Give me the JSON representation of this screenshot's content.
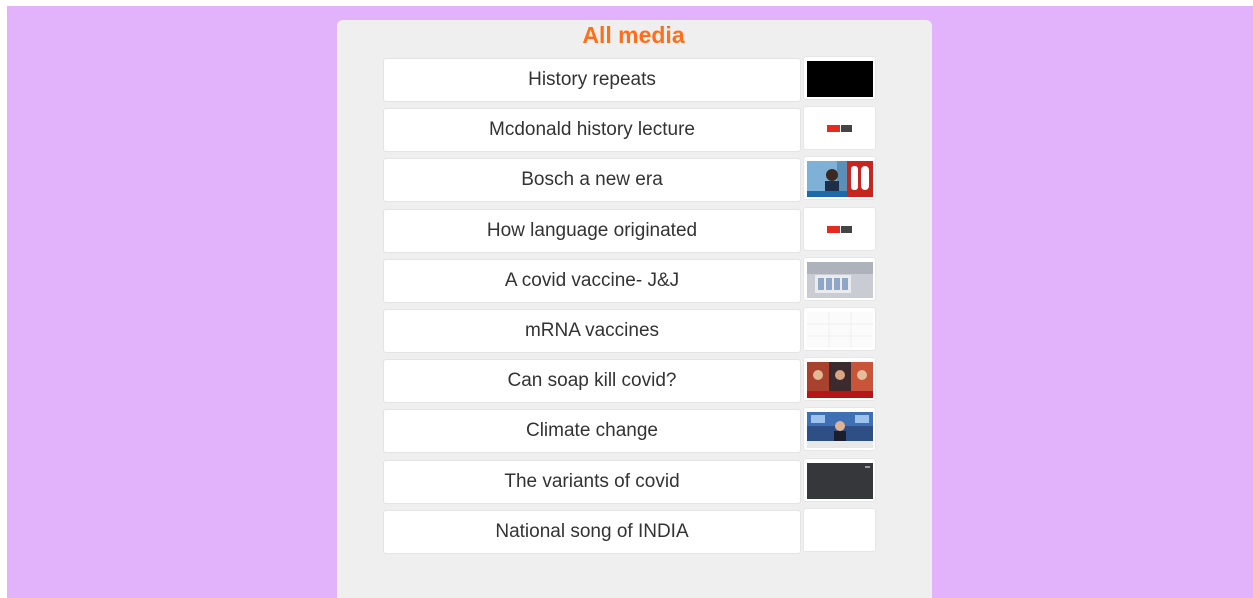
{
  "page": {
    "title": "All media"
  },
  "media_items": [
    {
      "title": "History repeats",
      "thumbnail": "black-video-thumbnail"
    },
    {
      "title": "Mcdonald history lecture",
      "thumbnail": "ted-ed-thumbnail"
    },
    {
      "title": "Bosch a new era",
      "thumbnail": "news-anchor-thumbnail"
    },
    {
      "title": "How language originated",
      "thumbnail": "ted-ed-thumbnail"
    },
    {
      "title": "A covid vaccine- J&J",
      "thumbnail": "vaccine-vials-thumbnail"
    },
    {
      "title": "mRNA vaccines",
      "thumbnail": "faint-grid-thumbnail"
    },
    {
      "title": "Can soap kill covid?",
      "thumbnail": "news-panel-thumbnail"
    },
    {
      "title": "Climate change",
      "thumbnail": "newsroom-thumbnail"
    },
    {
      "title": "The variants of covid",
      "thumbnail": "dark-video-thumbnail"
    },
    {
      "title": "National song of INDIA",
      "thumbnail": "blank-thumbnail"
    }
  ],
  "colors": {
    "page_background": "#e2b2fb",
    "panel_background": "#efefef",
    "title_color": "#ff6f1a"
  }
}
